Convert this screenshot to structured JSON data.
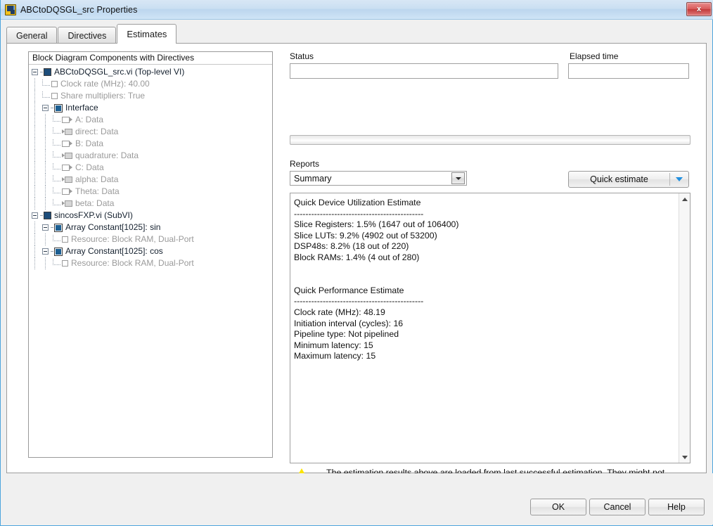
{
  "window": {
    "title": "ABCtoDQSGL_src Properties",
    "icon": "labview-vi-icon",
    "close_label": "x"
  },
  "tabs": [
    {
      "label": "General",
      "active": false
    },
    {
      "label": "Directives",
      "active": false
    },
    {
      "label": "Estimates",
      "active": true
    }
  ],
  "tree": {
    "header": "Block Diagram Components with Directives",
    "nodes": [
      {
        "label": "ABCtoDQSGL_src.vi (Top-level VI)",
        "depth": 0,
        "icon": "vi-icon",
        "expander": "minus",
        "style": "dark"
      },
      {
        "label": "Clock rate (MHz): 40.00",
        "depth": 1,
        "icon": "checkbox-icon",
        "expander": "none",
        "style": "dim"
      },
      {
        "label": "Share multipliers: True",
        "depth": 1,
        "icon": "checkbox-icon",
        "expander": "none",
        "style": "dim"
      },
      {
        "label": "Interface",
        "depth": 1,
        "icon": "vi-outline-icon",
        "expander": "minus",
        "style": "dark"
      },
      {
        "label": "A: Data",
        "depth": 2,
        "icon": "terminal-in-icon",
        "expander": "none",
        "style": "dim"
      },
      {
        "label": "direct: Data",
        "depth": 2,
        "icon": "terminal-out-icon",
        "expander": "none",
        "style": "dim"
      },
      {
        "label": "B: Data",
        "depth": 2,
        "icon": "terminal-in-icon",
        "expander": "none",
        "style": "dim"
      },
      {
        "label": "quadrature: Data",
        "depth": 2,
        "icon": "terminal-out-icon",
        "expander": "none",
        "style": "dim"
      },
      {
        "label": "C: Data",
        "depth": 2,
        "icon": "terminal-in-icon",
        "expander": "none",
        "style": "dim"
      },
      {
        "label": "alpha: Data",
        "depth": 2,
        "icon": "terminal-out-icon",
        "expander": "none",
        "style": "dim"
      },
      {
        "label": "Theta: Data",
        "depth": 2,
        "icon": "terminal-in-icon",
        "expander": "none",
        "style": "dim"
      },
      {
        "label": "beta: Data",
        "depth": 2,
        "icon": "terminal-out-icon",
        "expander": "none",
        "style": "dim"
      },
      {
        "label": "sincosFXP.vi (SubVI)",
        "depth": 0,
        "icon": "vi-icon",
        "expander": "minus",
        "style": "dark"
      },
      {
        "label": "Array Constant[1025]: sin",
        "depth": 1,
        "icon": "vi-outline-icon",
        "expander": "minus",
        "style": "dark"
      },
      {
        "label": "Resource: Block RAM, Dual-Port",
        "depth": 2,
        "icon": "checkbox-icon",
        "expander": "none",
        "style": "dim"
      },
      {
        "label": "Array Constant[1025]: cos",
        "depth": 1,
        "icon": "vi-outline-icon",
        "expander": "minus",
        "style": "dark"
      },
      {
        "label": "Resource: Block RAM, Dual-Port",
        "depth": 2,
        "icon": "checkbox-icon",
        "expander": "none",
        "style": "dim"
      }
    ]
  },
  "status": {
    "label": "Status",
    "value": "",
    "placeholder": ""
  },
  "elapsed": {
    "label": "Elapsed time",
    "value": "",
    "placeholder": ""
  },
  "progress": {
    "percent": 0
  },
  "reports": {
    "label": "Reports",
    "selected": "Summary",
    "options": [
      "Summary"
    ]
  },
  "quick_estimate": {
    "label": "Quick estimate",
    "dropdown_icon": "caret-down-icon"
  },
  "report_text": "Quick Device Utilization Estimate\n---------------------------------------------\nSlice Registers: 1.5% (1647 out of 106400)\nSlice LUTs: 9.2% (4902 out of 53200)\nDSP48s: 8.2% (18 out of 220)\nBlock RAMs: 1.4% (4 out of 280)\n\n\nQuick Performance Estimate\n---------------------------------------------\nClock rate (MHz): 48.19\nInitiation interval (cycles): 16\nPipeline type: Not pipelined\nMinimum latency: 15\nMaximum latency: 15",
  "warning": {
    "icon": "warning-triangle-icon",
    "text": "The estimation results above are loaded from last successful estimation. They might not reflect current directive settings. Run the estimation again to get the latest estimates."
  },
  "footer": {
    "ok": "OK",
    "cancel": "Cancel",
    "help": "Help"
  },
  "colors": {
    "titlebar": "#cadff2",
    "accent_blue": "#1f8fe0",
    "vi_icon": "#1d4d7a",
    "warning_yellow": "#fbe400",
    "close_red": "#d95b5b"
  }
}
